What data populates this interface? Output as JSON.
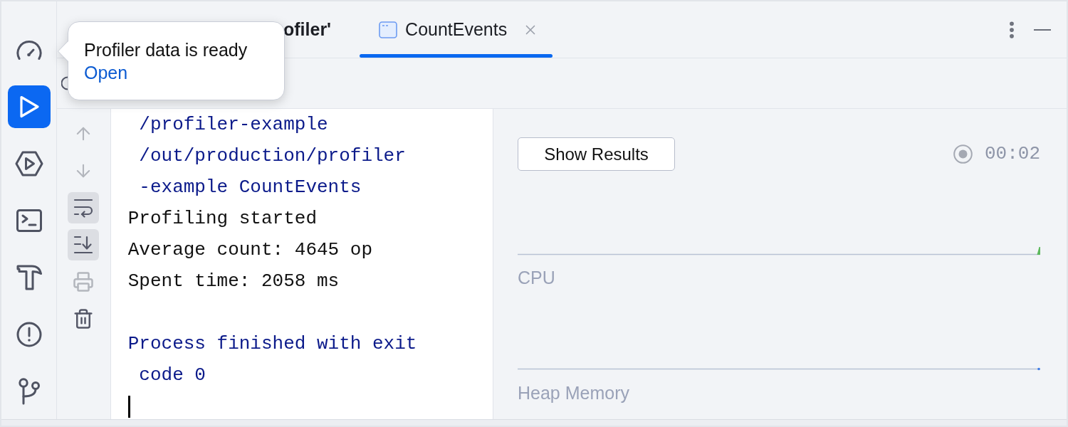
{
  "sidebar": {
    "items": [
      {
        "selected": false
      },
      {
        "selected": true
      },
      {
        "selected": false
      },
      {
        "selected": false
      },
      {
        "selected": false
      },
      {
        "selected": false
      },
      {
        "selected": false
      }
    ]
  },
  "tabs": [
    {
      "label": "ofiler'",
      "selected": false,
      "bold": true,
      "partly_hidden": true
    },
    {
      "label": "CountEvents",
      "selected": true,
      "bold": false,
      "partly_hidden": false
    }
  ],
  "notification": {
    "message": "Profiler data is ready",
    "link": "Open"
  },
  "console_tools": [
    {
      "disabled": true,
      "toggled": false
    },
    {
      "disabled": true,
      "toggled": false
    },
    {
      "disabled": false,
      "toggled": true
    },
    {
      "disabled": false,
      "toggled": true
    },
    {
      "disabled": true,
      "toggled": false
    },
    {
      "disabled": false,
      "toggled": false
    }
  ],
  "console": {
    "lines": [
      {
        "text": " /profiler-example",
        "kind": "system"
      },
      {
        "text": " /out/production/profiler",
        "kind": "system"
      },
      {
        "text": " -example CountEvents",
        "kind": "system"
      },
      {
        "text": "Profiling started",
        "kind": "output"
      },
      {
        "text": "Average count: 4645 op",
        "kind": "output"
      },
      {
        "text": "Spent time: 2058 ms",
        "kind": "output"
      },
      {
        "text": "Process finished with exit",
        "kind": "system"
      },
      {
        "text": " code 0",
        "kind": "system"
      }
    ]
  },
  "profiler": {
    "button": "Show Results",
    "timer": "00:02",
    "graphs": [
      {
        "label": "CPU",
        "color": "#5cb85c"
      },
      {
        "label": "Heap Memory",
        "color": "#3d7ce8"
      }
    ]
  }
}
